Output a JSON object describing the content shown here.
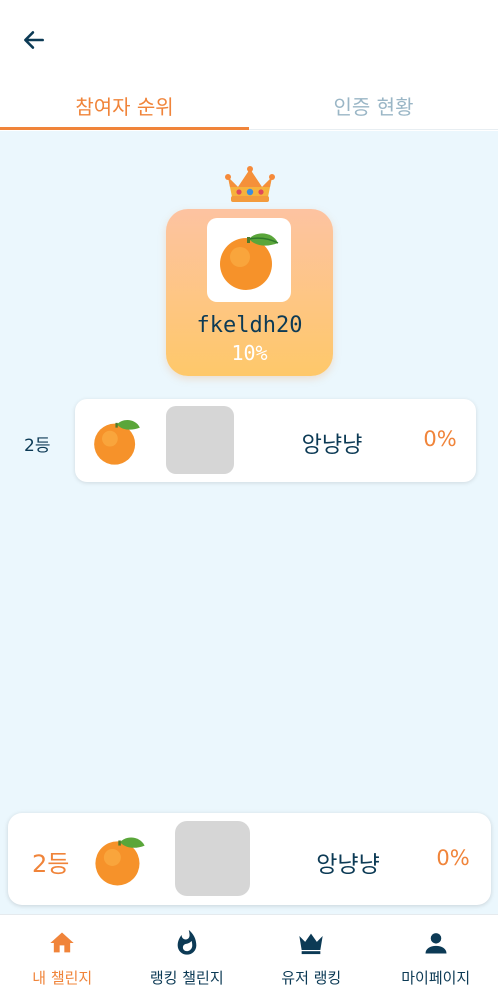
{
  "header": {
    "back_icon": "arrow-left-icon"
  },
  "tabs": [
    {
      "label": "참여자 순위",
      "active": true
    },
    {
      "label": "인증 현황",
      "active": false
    }
  ],
  "winner": {
    "crown_icon": "crown-icon",
    "avatar_icon": "orange-icon",
    "name": "fkeldh20",
    "percent": "10%"
  },
  "ranking": [
    {
      "rank": "2등",
      "fruit_icon": "orange-icon",
      "name": "앙냥냥",
      "percent": "0%"
    }
  ],
  "my_rank": {
    "rank": "2등",
    "fruit_icon": "orange-icon",
    "name": "앙냥냥",
    "percent": "0%"
  },
  "bottom_nav": [
    {
      "label": "내 챌린지",
      "icon": "home-icon",
      "active": true
    },
    {
      "label": "랭킹 챌린지",
      "icon": "flame-icon",
      "active": false
    },
    {
      "label": "유저 랭킹",
      "icon": "crown-icon",
      "active": false
    },
    {
      "label": "마이페이지",
      "icon": "person-icon",
      "active": false
    }
  ],
  "colors": {
    "accent": "#f0843a",
    "primary_text": "#0c3a55",
    "inactive_tab": "#9ab6c6",
    "background": "#ebf7fd",
    "photo_placeholder": "#d6d6d6"
  }
}
